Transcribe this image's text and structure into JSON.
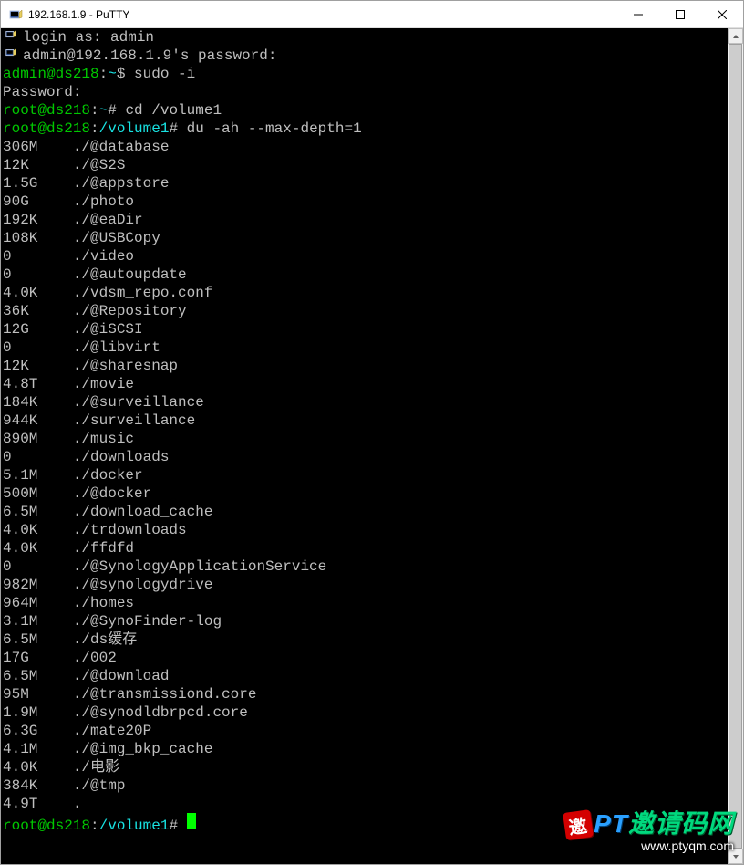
{
  "window": {
    "title": "192.168.1.9 - PuTTY"
  },
  "session": {
    "login_prompt": "login as: ",
    "login_user": "admin",
    "password_prompt_line": "admin@192.168.1.9's password:",
    "prompt1_user": "admin@ds218",
    "prompt1_path": "~",
    "prompt1_cmd": "sudo -i",
    "password_label": "Password:",
    "prompt2_user": "root@ds218",
    "prompt2_path": "~",
    "prompt2_cmd": "cd /volume1",
    "prompt3_user": "root@ds218",
    "prompt3_path": "/volume1",
    "prompt3_cmd": "du -ah --max-depth=1",
    "prompt4_user": "root@ds218",
    "prompt4_path": "/volume1"
  },
  "du_rows": [
    {
      "size": "306M",
      "path": "./@database"
    },
    {
      "size": "12K",
      "path": "./@S2S"
    },
    {
      "size": "1.5G",
      "path": "./@appstore"
    },
    {
      "size": "90G",
      "path": "./photo"
    },
    {
      "size": "192K",
      "path": "./@eaDir"
    },
    {
      "size": "108K",
      "path": "./@USBCopy"
    },
    {
      "size": "0",
      "path": "./video"
    },
    {
      "size": "0",
      "path": "./@autoupdate"
    },
    {
      "size": "4.0K",
      "path": "./vdsm_repo.conf"
    },
    {
      "size": "36K",
      "path": "./@Repository"
    },
    {
      "size": "12G",
      "path": "./@iSCSI"
    },
    {
      "size": "0",
      "path": "./@libvirt"
    },
    {
      "size": "12K",
      "path": "./@sharesnap"
    },
    {
      "size": "4.8T",
      "path": "./movie"
    },
    {
      "size": "184K",
      "path": "./@surveillance"
    },
    {
      "size": "944K",
      "path": "./surveillance"
    },
    {
      "size": "890M",
      "path": "./music"
    },
    {
      "size": "0",
      "path": "./downloads"
    },
    {
      "size": "5.1M",
      "path": "./docker"
    },
    {
      "size": "500M",
      "path": "./@docker"
    },
    {
      "size": "6.5M",
      "path": "./download_cache"
    },
    {
      "size": "4.0K",
      "path": "./trdownloads"
    },
    {
      "size": "4.0K",
      "path": "./ffdfd"
    },
    {
      "size": "0",
      "path": "./@SynologyApplicationService"
    },
    {
      "size": "982M",
      "path": "./@synologydrive"
    },
    {
      "size": "964M",
      "path": "./homes"
    },
    {
      "size": "3.1M",
      "path": "./@SynoFinder-log"
    },
    {
      "size": "6.5M",
      "path": "./ds缓存"
    },
    {
      "size": "17G",
      "path": "./002"
    },
    {
      "size": "6.5M",
      "path": "./@download"
    },
    {
      "size": "95M",
      "path": "./@transmissiond.core"
    },
    {
      "size": "1.9M",
      "path": "./@synodldbrpcd.core"
    },
    {
      "size": "6.3G",
      "path": "./mate20P"
    },
    {
      "size": "4.1M",
      "path": "./@img_bkp_cache"
    },
    {
      "size": "4.0K",
      "path": "./电影"
    },
    {
      "size": "384K",
      "path": "./@tmp"
    },
    {
      "size": "4.9T",
      "path": "."
    }
  ],
  "watermark": {
    "badge": "邀",
    "text1": "PT",
    "text2": "邀请码网",
    "url": "www.ptyqm.com"
  }
}
